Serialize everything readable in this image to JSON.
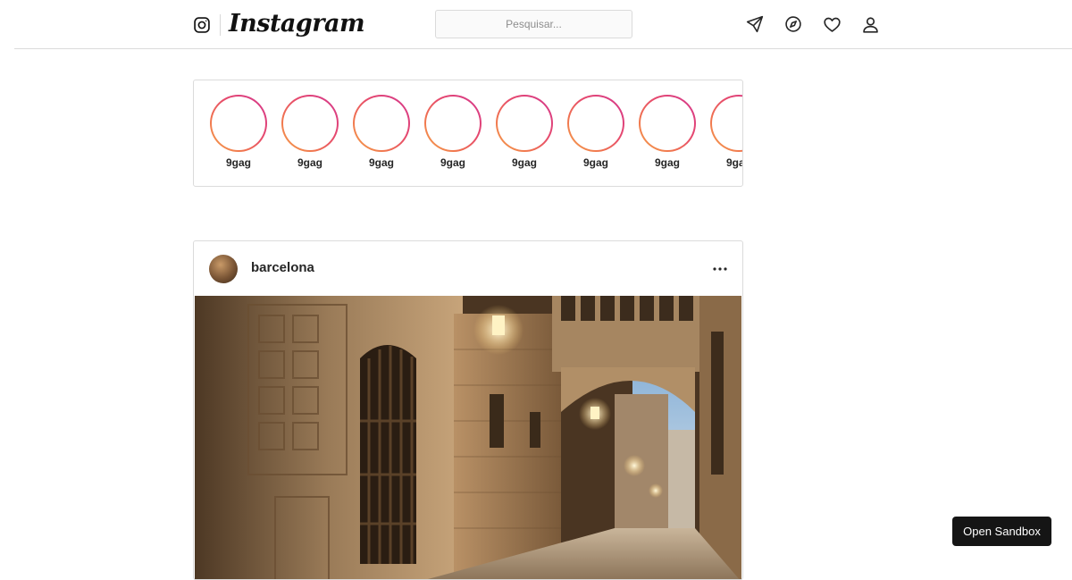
{
  "header": {
    "brand_icon": "instagram-glyph-icon",
    "brand_name": "Instagram",
    "search_placeholder": "Pesquisar...",
    "nav_icons": [
      "direct-send-icon",
      "explore-compass-icon",
      "activity-heart-icon",
      "profile-person-icon"
    ]
  },
  "stories": [
    {
      "name": "9gag"
    },
    {
      "name": "9gag"
    },
    {
      "name": "9gag"
    },
    {
      "name": "9gag"
    },
    {
      "name": "9gag"
    },
    {
      "name": "9gag"
    },
    {
      "name": "9gag"
    },
    {
      "name": "9gag"
    }
  ],
  "post": {
    "username": "barcelona",
    "more_icon": "more-options-icon",
    "image": "barcelona-gothic-quarter-street-photo"
  },
  "sandbox": {
    "label": "Open Sandbox"
  },
  "colors": {
    "story_ring_start": "#f5a24d",
    "story_ring_end": "#d3378f",
    "border": "#dbdbdb",
    "sandbox_bg": "#151515"
  }
}
